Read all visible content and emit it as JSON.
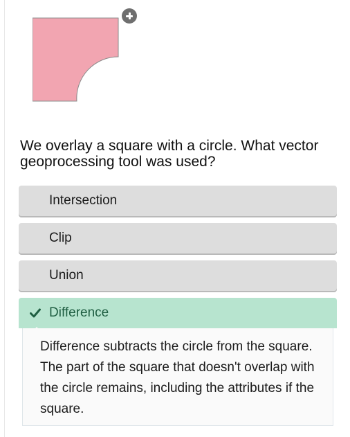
{
  "figure": {
    "shape_fill": "#f2a5b1",
    "shape_stroke": "#8a8a8a",
    "zoom_icon": "plus-circle-icon"
  },
  "question": {
    "text": "We overlay a square with a circle. What vector geoprocessing tool was used?"
  },
  "answers": [
    {
      "label": "Intersection",
      "state": "default"
    },
    {
      "label": "Clip",
      "state": "default"
    },
    {
      "label": "Union",
      "state": "default"
    },
    {
      "label": "Difference",
      "state": "correct",
      "icon": "checkmark-icon"
    }
  ],
  "feedback": {
    "text": "Difference subtracts the circle from the square. The part of the square that doesn't overlap with the circle remains, including the attributes if the square."
  },
  "colors": {
    "answer_bg": "#dddddd",
    "correct_bg": "#b7e4cf",
    "correct_text": "#1f5e42"
  }
}
